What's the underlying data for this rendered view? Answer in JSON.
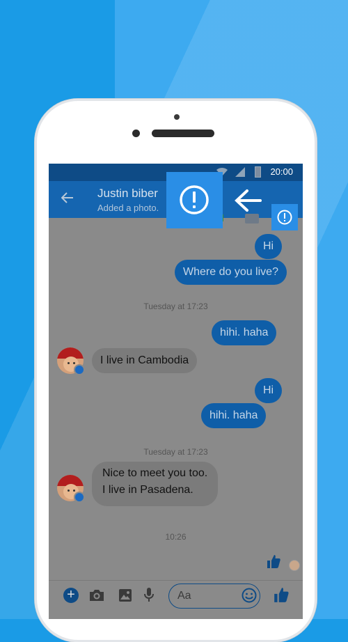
{
  "statusbar": {
    "time": "20:00"
  },
  "header": {
    "contact_name": "Justin biber",
    "contact_subtitle": "Added a photo."
  },
  "messages": [
    {
      "dir": "out",
      "text": "Hi"
    },
    {
      "dir": "out",
      "text": "Where do you live?"
    },
    {
      "type": "stamp",
      "text": "Tuesday at 17:23"
    },
    {
      "dir": "out",
      "text": "hihi. haha"
    },
    {
      "dir": "in",
      "text": "I live in Cambodia"
    },
    {
      "dir": "out",
      "text": "Hi"
    },
    {
      "dir": "out",
      "text": "hihi. haha"
    },
    {
      "type": "stamp",
      "text": "Tuesday at 17:23"
    },
    {
      "dir": "in",
      "lines": [
        "Nice to meet you too.",
        "I live in Pasadena."
      ]
    },
    {
      "type": "stamp",
      "text": "10:26"
    }
  ],
  "composer": {
    "placeholder": "Aa"
  },
  "icons": {
    "back": "arrow-left-icon",
    "info": "info-icon",
    "add": "plus-icon",
    "camera": "camera-icon",
    "gallery": "image-icon",
    "mic": "microphone-icon",
    "emoji": "emoji-icon",
    "like": "thumbs-up-icon"
  },
  "colors": {
    "background": "#1a9be6",
    "appbar": "#1565b0",
    "statusbar": "#0e4b86",
    "outgoing_bubble": "#0f5ea8",
    "incoming_bubble": "#7b7b7b",
    "highlight": "#2a8ee6"
  }
}
